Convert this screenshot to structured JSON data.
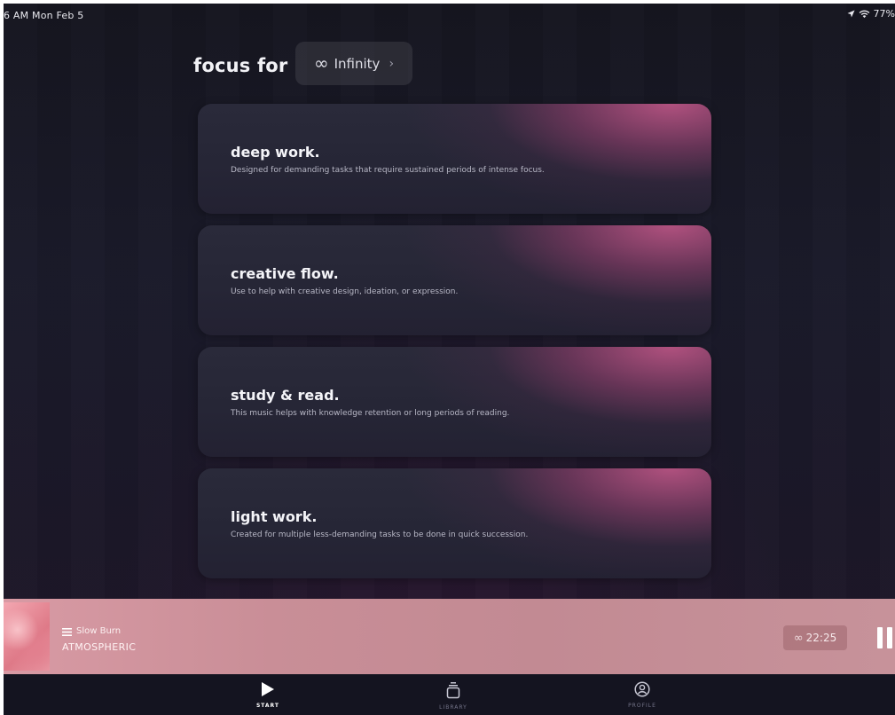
{
  "status_bar": {
    "time": "6 AM  Mon Feb 5",
    "battery": "77%"
  },
  "header": {
    "title": "focus for",
    "duration": {
      "icon": "infinity-icon",
      "symbol": "∞",
      "label": "Infinity",
      "chevron": "›"
    }
  },
  "modes": [
    {
      "title": "deep work.",
      "description": "Designed for demanding tasks that require sustained periods of intense focus."
    },
    {
      "title": "creative flow.",
      "description": "Use to help with creative design, ideation, or expression."
    },
    {
      "title": "study & read.",
      "description": "This music helps with knowledge retention or long periods of reading."
    },
    {
      "title": "light work.",
      "description": "Created for multiple less-demanding tasks to be done in quick succession."
    }
  ],
  "now_playing": {
    "track": "Slow Burn",
    "genre": "ATMOSPHERIC",
    "timer_symbol": "∞",
    "timer": "22:25"
  },
  "tabs": [
    {
      "label": "START",
      "icon": "play-icon",
      "active": true
    },
    {
      "label": "LIBRARY",
      "icon": "library-icon",
      "active": false
    },
    {
      "label": "PROFILE",
      "icon": "profile-icon",
      "active": false
    }
  ],
  "colors": {
    "accent_pink": "#d65c92",
    "player_bar": "#c98e97",
    "background": "#1a1a2a"
  }
}
